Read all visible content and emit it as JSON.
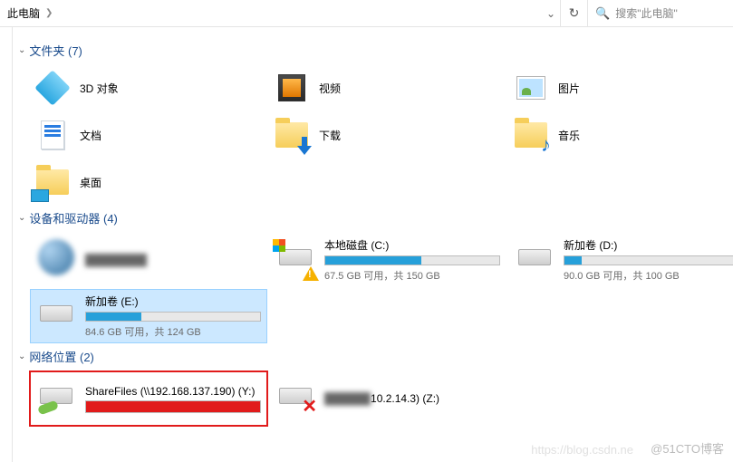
{
  "breadcrumb": {
    "location": "此电脑"
  },
  "search": {
    "placeholder": "搜索\"此电脑\""
  },
  "groups": {
    "folders": {
      "title": "文件夹 (7)"
    },
    "drives": {
      "title": "设备和驱动器 (4)"
    },
    "network": {
      "title": "网络位置 (2)"
    }
  },
  "folders": [
    {
      "name": "3D 对象"
    },
    {
      "name": "视频"
    },
    {
      "name": "图片"
    },
    {
      "name": "文档"
    },
    {
      "name": "下载"
    },
    {
      "name": "音乐"
    },
    {
      "name": "桌面"
    }
  ],
  "drives": [
    {
      "name": "",
      "free": "",
      "obscured": true
    },
    {
      "name": "本地磁盘 (C:)",
      "free": "67.5 GB 可用，共 150 GB",
      "fill": 55,
      "warn": true,
      "win": true
    },
    {
      "name": "新加卷 (D:)",
      "free": "90.0 GB 可用，共 100 GB",
      "fill": 10
    },
    {
      "name": "新加卷 (E:)",
      "free": "84.6 GB 可用，共 124 GB",
      "fill": 32,
      "selected": true
    }
  ],
  "network": [
    {
      "name": "ShareFiles (\\\\192.168.137.190) (Y:)",
      "fill": 100,
      "red": true,
      "highlight": true
    },
    {
      "name": "10.2.14.3) (Z:)",
      "error": true,
      "obscured": true
    }
  ],
  "watermark": "@51CTO博客",
  "watermark2": "https://blog.csdn.ne"
}
